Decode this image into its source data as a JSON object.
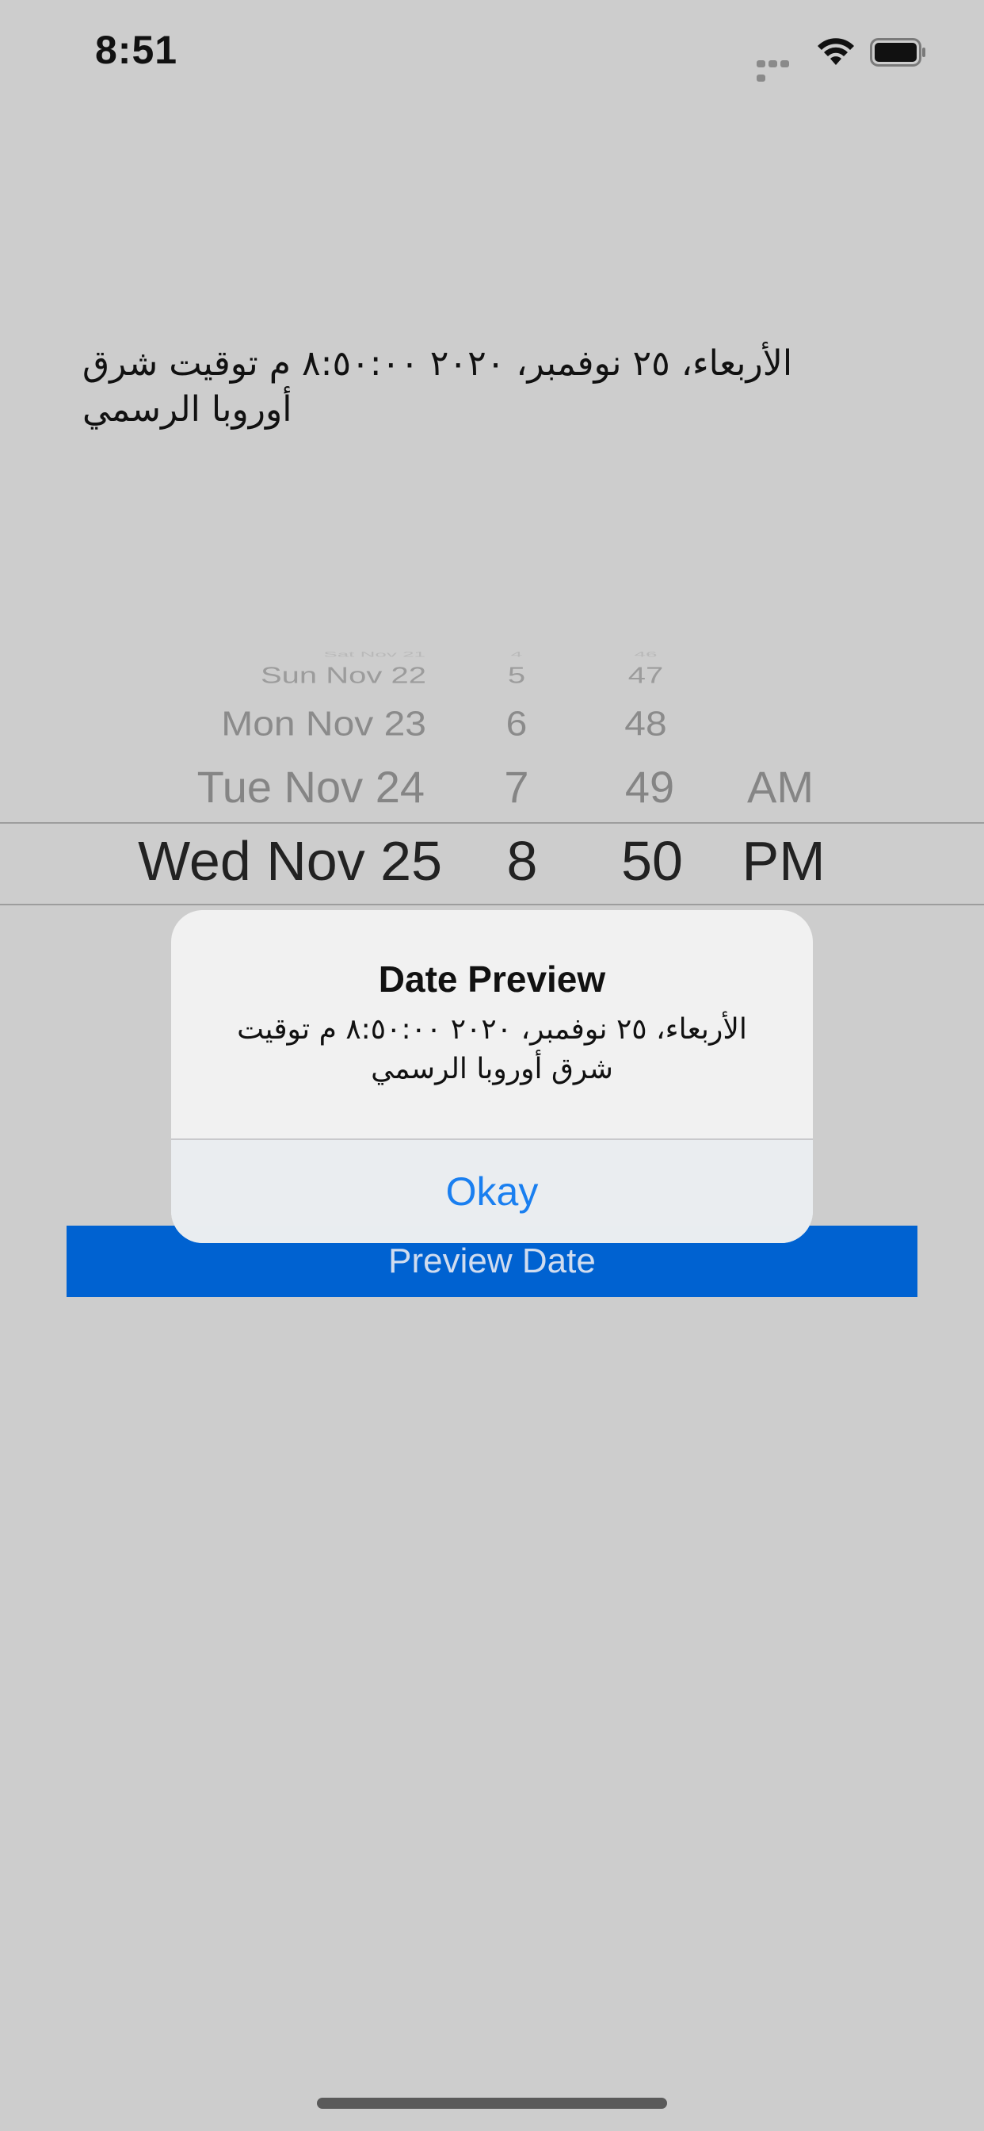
{
  "status_bar": {
    "time": "8:51"
  },
  "main": {
    "date_label": "الأربعاء، ٢٥ نوفمبر، ٢٠٢٠ ٨:٥٠:٠٠ م توقيت شرق أوروبا الرسمي"
  },
  "picker": {
    "dates": [
      "Sat Nov 21",
      "Sun Nov 22",
      "Mon Nov 23",
      "Tue Nov 24",
      "Wed Nov 25"
    ],
    "hours": [
      "4",
      "5",
      "6",
      "7",
      "8"
    ],
    "minutes": [
      "46",
      "47",
      "48",
      "49",
      "50"
    ],
    "periods": [
      "AM",
      "PM"
    ],
    "selected": {
      "date": "Wed Nov 25",
      "hour": "8",
      "minute": "50",
      "period": "PM"
    }
  },
  "alert": {
    "title": "Date Preview",
    "message": "الأربعاء، ٢٥ نوفمبر، ٢٠٢٠ ٨:٥٠:٠٠ م توقيت شرق أوروبا الرسمي",
    "button_label": "Okay"
  },
  "preview_button": {
    "label": "Preview Date"
  },
  "colors": {
    "background": "#cdcdcd",
    "button_blue": "#0062d1",
    "alert_action": "#1a7ff0"
  }
}
